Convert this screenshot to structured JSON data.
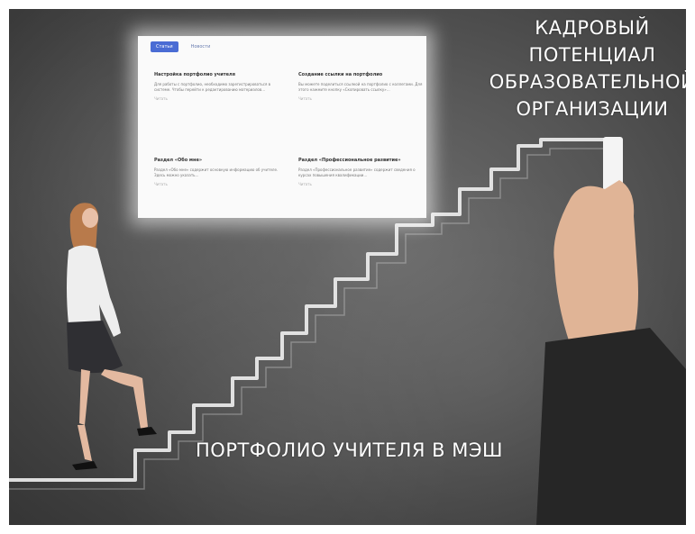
{
  "heading": {
    "lines": [
      "КАДРОВЫЙ",
      "ПОТЕНЦИАЛ",
      "ОБРАЗОВАТЕЛЬНОЙ",
      "ОРГАНИЗАЦИИ"
    ]
  },
  "caption": "ПОРТФОЛИО УЧИТЕЛЯ В МЭШ",
  "screen": {
    "tabs": [
      "Статьи",
      "Новости"
    ],
    "cards": [
      {
        "title": "Настройка портфолио учителя",
        "text": "Для работы с портфолио, необходимо зарегистрироваться в системе. Чтобы перейти к редактированию материалов…",
        "link": "Читать"
      },
      {
        "title": "Создание ссылки на портфолио",
        "text": "Вы можете поделиться ссылкой на портфолио с коллегами. Для этого нажмите кнопку «Скопировать ссылку»…",
        "link": "Читать"
      },
      {
        "title": "Раздел «Обо мне»",
        "text": "Раздел «Обо мне» содержит основную информацию об учителе. Здесь можно указать…",
        "link": "Читать"
      },
      {
        "title": "Раздел «Профессиональное развитие»",
        "text": "Раздел «Профессиональное развитие» содержит сведения о курсах повышения квалификации…",
        "link": "Читать"
      }
    ]
  },
  "colors": {
    "chalkboard": "#555555",
    "chalk": "#f2f2f2",
    "accent_tab": "#4a6cd4"
  }
}
